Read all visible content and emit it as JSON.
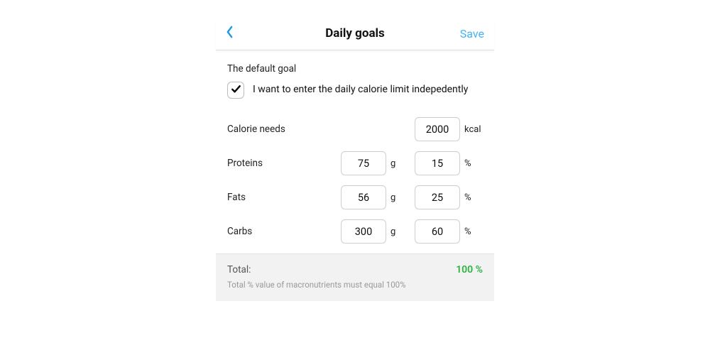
{
  "header": {
    "title": "Daily goals",
    "save_label": "Save"
  },
  "default_goal": {
    "section_label": "The default goal",
    "checkbox": {
      "checked": true,
      "label": "I want to enter the daily calorie limit indepedently"
    }
  },
  "calorie_needs": {
    "label": "Calorie needs",
    "value": "2000",
    "unit": "kcal"
  },
  "macros": [
    {
      "key": "proteins",
      "label": "Proteins",
      "grams": "75",
      "g_unit": "g",
      "percent": "15",
      "p_unit": "%"
    },
    {
      "key": "fats",
      "label": "Fats",
      "grams": "56",
      "g_unit": "g",
      "percent": "25",
      "p_unit": "%"
    },
    {
      "key": "carbs",
      "label": "Carbs",
      "grams": "300",
      "g_unit": "g",
      "percent": "60",
      "p_unit": "%"
    }
  ],
  "total": {
    "label": "Total:",
    "value": "100 %",
    "hint": "Total % value of macronutrients must equal 100%"
  },
  "colors": {
    "accent": "#1b97e5",
    "save": "#43b3f2",
    "success": "#2cb03f"
  }
}
